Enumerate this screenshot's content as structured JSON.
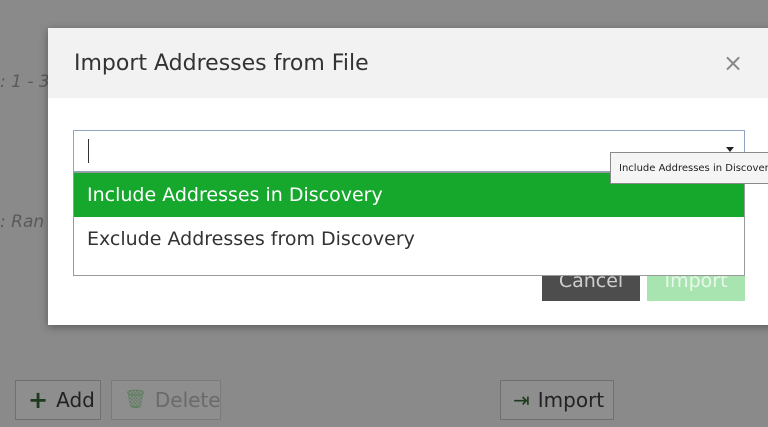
{
  "background": {
    "fragment_range_1": ": 1 - 3",
    "fragment_range_2": ": Ran",
    "add_label": "Add",
    "delete_label": "Delete",
    "import_label": "Import"
  },
  "modal": {
    "title": "Import Addresses from File",
    "close_glyph": "×",
    "select": {
      "value": "",
      "options": [
        {
          "label": "Include Addresses in Discovery",
          "selected": true
        },
        {
          "label": "Exclude Addresses from Discovery",
          "selected": false
        }
      ]
    },
    "tooltip_text": "Include Addresses in Discovery",
    "cancel_label": "Cancel",
    "import_label": "Import"
  },
  "icons": {
    "add": "plus-icon",
    "delete": "trash-icon",
    "import": "import-icon",
    "close": "close-icon",
    "dropdown": "chevron-down-icon"
  },
  "colors": {
    "selected_option_bg": "#15a82c",
    "cancel_bg": "#4d4d4d",
    "import_disabled_bg": "#a8e4b0",
    "overlay": "#8a8a8a"
  }
}
